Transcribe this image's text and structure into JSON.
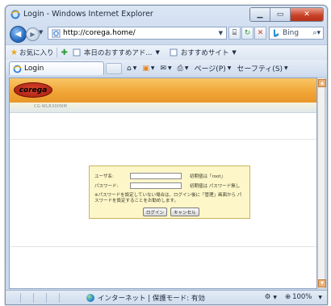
{
  "window": {
    "title": "Login - Windows Internet Explorer",
    "min": "▁",
    "max": "▭",
    "close": "✕"
  },
  "nav": {
    "address": "http://corega.home/",
    "search_placeholder": "Bing"
  },
  "favorites": {
    "label": "お気に入り",
    "items": [
      "本日のおすすめアド...",
      "おすすめサイト"
    ]
  },
  "tab": {
    "label": "Login"
  },
  "commands": {
    "page": "ページ(P)",
    "safety": "セーフティ(S)"
  },
  "page": {
    "logo": "corega",
    "model": "CG-WLR300NM"
  },
  "login": {
    "username_label": "ユーザ名:",
    "username_hint": "初期値は「root」",
    "password_label": "パスワード:",
    "password_hint": "初期値は パスワード無し",
    "note": "※パスワードを設定していない場合は、ログイン後に「管理」画面から パスワードを設定することをお勧めします。",
    "login_button": "ログイン",
    "cancel_button": "キャンセル"
  },
  "status": {
    "zone": "インターネット | 保護モード: 有効",
    "zoom": "100%"
  },
  "colors": {
    "banner": "#f0a434",
    "login_box": "#fdf6c9",
    "close_button": "#c9432a"
  }
}
